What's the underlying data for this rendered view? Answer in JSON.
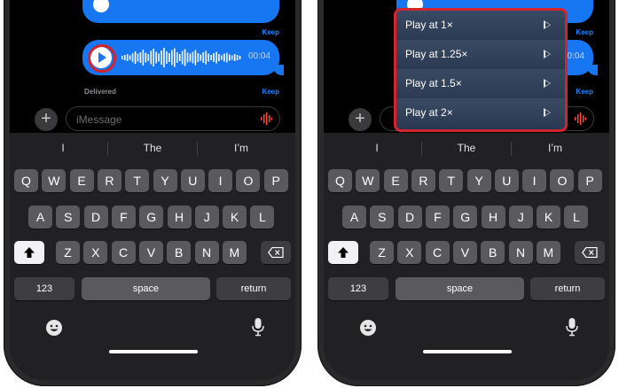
{
  "colors": {
    "accent": "#1777f3",
    "highlight": "#d4232a",
    "keyboard": "#212124"
  },
  "message": {
    "duration": "00:04",
    "delivered_label": "Delivered",
    "keep_label": "Keep"
  },
  "compose": {
    "placeholder": "iMessage"
  },
  "suggestions": [
    "I",
    "The",
    "I’m"
  ],
  "keyboard": {
    "row1": [
      "Q",
      "W",
      "E",
      "R",
      "T",
      "Y",
      "U",
      "I",
      "O",
      "P"
    ],
    "row2": [
      "A",
      "S",
      "D",
      "F",
      "G",
      "H",
      "J",
      "K",
      "L"
    ],
    "row3": [
      "Z",
      "X",
      "C",
      "V",
      "B",
      "N",
      "M"
    ],
    "numbers_label": "123",
    "space_label": "space",
    "return_label": "return"
  },
  "icons": {
    "play": "play-icon",
    "shift": "shift-icon",
    "backspace": "backspace-icon",
    "emoji": "emoji-icon",
    "mic": "mic-icon",
    "plus": "plus-icon",
    "audio": "audio-waveform-icon"
  },
  "speed_menu": {
    "items": [
      {
        "label": "Play at 1×"
      },
      {
        "label": "Play at 1.25×"
      },
      {
        "label": "Play at 1.5×"
      },
      {
        "label": "Play at 2×"
      }
    ]
  }
}
